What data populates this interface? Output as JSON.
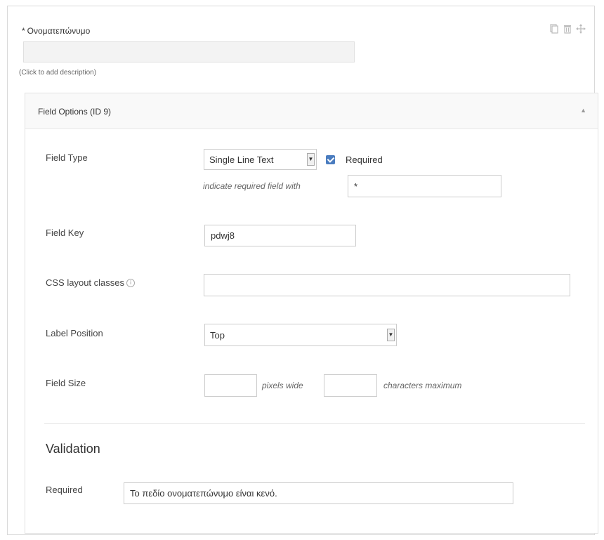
{
  "field": {
    "required_star": "*",
    "label": "Ονοματεπώνυμο",
    "description_hint": "(Click to add description)"
  },
  "toolbar": {
    "icons": [
      "duplicate-icon",
      "trash-icon",
      "move-icon"
    ]
  },
  "options": {
    "title": "Field Options (ID 9)",
    "collapse_symbol": "▲",
    "field_type": {
      "label": "Field Type",
      "selected": "Single Line Text",
      "required_label": "Required",
      "required_checked": true,
      "indicator_note": "indicate required field with",
      "indicator_value": "*"
    },
    "field_key": {
      "label": "Field Key",
      "value": "pdwj8"
    },
    "css_classes": {
      "label": "CSS layout classes",
      "value": ""
    },
    "label_position": {
      "label": "Label Position",
      "selected": "Top"
    },
    "field_size": {
      "label": "Field Size",
      "pixels_value": "",
      "pixels_note": "pixels wide",
      "chars_value": "",
      "chars_note": "characters maximum"
    },
    "validation": {
      "title": "Validation",
      "required_label": "Required",
      "required_message": "Το πεδίο ονοματεπώνυμο είναι κενό."
    }
  }
}
